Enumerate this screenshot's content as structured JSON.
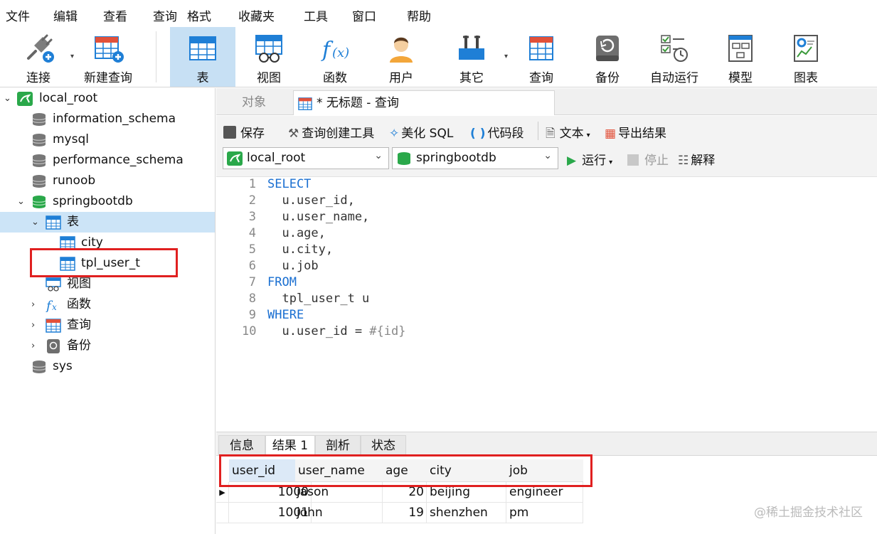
{
  "menu": [
    "文件",
    "编辑",
    "查看",
    "查询",
    "格式",
    "收藏夹",
    "工具",
    "窗口",
    "帮助"
  ],
  "toolbar": {
    "connect": "连接",
    "new_query": "新建查询",
    "table": "表",
    "view": "视图",
    "function": "函数",
    "user": "用户",
    "other": "其它",
    "query": "查询",
    "backup": "备份",
    "auto_run": "自动运行",
    "model": "模型",
    "chart": "图表"
  },
  "tree": {
    "connection": "local_root",
    "databases": [
      "information_schema",
      "mysql",
      "performance_schema",
      "runoob",
      "springbootdb",
      "sys"
    ],
    "springbootdb_children": {
      "tables": "表",
      "table_items": [
        "city",
        "tpl_user_t"
      ],
      "views": "视图",
      "functions": "函数",
      "queries": "查询",
      "backups": "备份"
    }
  },
  "tabs": {
    "object": "对象",
    "current": "* 无标题 - 查询"
  },
  "query_toolbar": {
    "save": "保存",
    "query_builder": "查询创建工具",
    "beautify": "美化 SQL",
    "snippet": "代码段",
    "text": "文本",
    "export": "导出结果",
    "connection": "local_root",
    "database": "springbootdb",
    "run": "运行",
    "stop": "停止",
    "explain": "解释"
  },
  "editor": {
    "line_numbers": [
      "1",
      "2",
      "3",
      "4",
      "5",
      "6",
      "7",
      "8",
      "9",
      "10"
    ],
    "lines": {
      "l1": "SELECT",
      "l2": "  u.user_id,",
      "l3": "  u.user_name,",
      "l4": "  u.age,",
      "l5": "  u.city,",
      "l6": "  u.job",
      "l7": "FROM",
      "l8": "  tpl_user_t u",
      "l9": "WHERE",
      "l10a": "  u.user_id = ",
      "l10b": "#{id}"
    }
  },
  "result_tabs": [
    "信息",
    "结果 1",
    "剖析",
    "状态"
  ],
  "result": {
    "columns": [
      "user_id",
      "user_name",
      "age",
      "city",
      "job"
    ],
    "rows": [
      [
        "1000",
        "jason",
        "20",
        "beijing",
        "engineer"
      ],
      [
        "1001",
        "john",
        "19",
        "shenzhen",
        "pm"
      ]
    ]
  },
  "watermark": "@稀土掘金技术社区",
  "colors": {
    "keyword": "#1a6fd1",
    "highlight_box": "#e02020",
    "selection": "#cce4f7",
    "active_tool": "#c7e0f4"
  }
}
